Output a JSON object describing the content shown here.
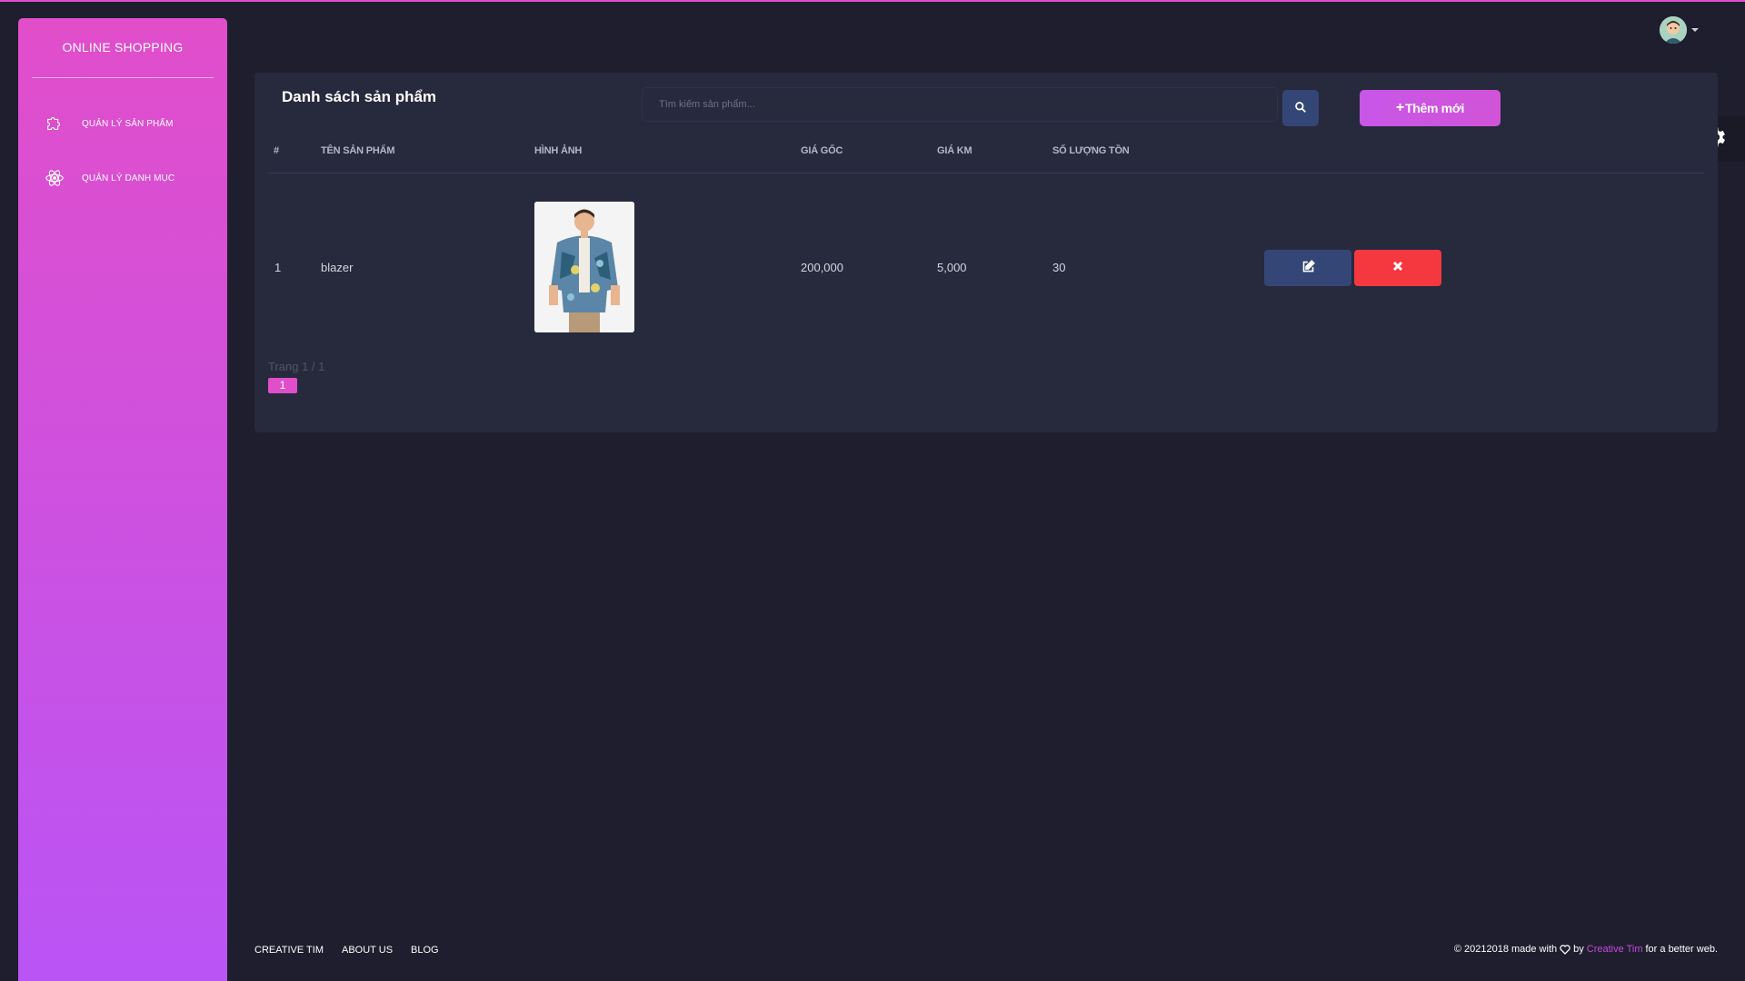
{
  "theme": {
    "accent": "#e14eca",
    "accent_end": "#ba54f5",
    "danger": "#f5383f",
    "info": "#344675",
    "card_bg": "#27293d",
    "page_bg": "#1e1e2e"
  },
  "sidebar": {
    "brand": "ONLINE SHOPPING",
    "items": [
      {
        "label": "QUẢN LÝ SẢN PHẨM",
        "icon": "puzzle-icon"
      },
      {
        "label": "QUẢN LÝ DANH MỤC",
        "icon": "atom-icon"
      }
    ]
  },
  "header": {
    "avatar": "user-avatar",
    "settings_icon": "gear-icon"
  },
  "card": {
    "title": "Danh sách sản phẩm",
    "search": {
      "placeholder": "Tìm kiếm sản phẩm...",
      "value": "",
      "icon": "search-icon"
    },
    "add_button": {
      "plus": "+",
      "label": "Thêm mới"
    },
    "table": {
      "columns": [
        "#",
        "TÊN SẢN PHẨM",
        "HÌNH ẢNH",
        "GIÁ GỐC",
        "GIÁ KM",
        "SỐ LƯỢNG TỒN"
      ],
      "rows": [
        {
          "index": "1",
          "name": "blazer",
          "image": "product-photo-floral-shirt",
          "price": "200,000",
          "sale_price": "5,000",
          "stock": "30",
          "edit_icon": "edit-icon",
          "delete_icon": "close-icon"
        }
      ]
    },
    "pagination": {
      "info": "Trang 1 / 1",
      "pages": [
        "1"
      ]
    }
  },
  "footer": {
    "links": [
      "CREATIVE TIM",
      "ABOUT US",
      "BLOG"
    ],
    "copyright_prefix": "© 20212018 made with",
    "copyright_by": "by",
    "copyright_brand": "Creative Tim",
    "copyright_suffix": "for a better web."
  }
}
